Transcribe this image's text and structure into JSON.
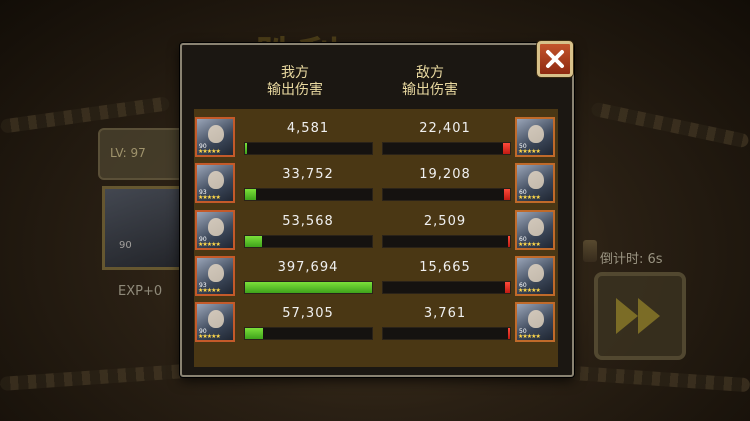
{
  "background": {
    "title_text": "胜利",
    "level_text": "LV: 97",
    "hero_level": "90",
    "exp_text": "EXP+0",
    "countdown_text": "倒计时: 6s"
  },
  "panel": {
    "our_header": [
      "我方",
      "输出伤害"
    ],
    "enemy_header": [
      "敌方",
      "输出伤害"
    ]
  },
  "colors": {
    "our_bar": "#5fd02a",
    "enemy_bar": "#e02a1f",
    "accent": "#c4552c"
  },
  "rows": [
    {
      "our_level": "90",
      "our_damage": "4,581",
      "our_fill": 0.0115,
      "enemy_level": "50",
      "enemy_damage": "22,401",
      "enemy_fill": 0.0563
    },
    {
      "our_level": "93",
      "our_damage": "33,752",
      "our_fill": 0.0849,
      "enemy_level": "60",
      "enemy_damage": "19,208",
      "enemy_fill": 0.0483
    },
    {
      "our_level": "90",
      "our_damage": "53,568",
      "our_fill": 0.1347,
      "enemy_level": "60",
      "enemy_damage": "2,509",
      "enemy_fill": 0.0063
    },
    {
      "our_level": "93",
      "our_damage": "397,694",
      "our_fill": 1.0,
      "enemy_level": "60",
      "enemy_damage": "15,665",
      "enemy_fill": 0.0394
    },
    {
      "our_level": "90",
      "our_damage": "57,305",
      "our_fill": 0.1441,
      "enemy_level": "50",
      "enemy_damage": "3,761",
      "enemy_fill": 0.0095
    }
  ]
}
